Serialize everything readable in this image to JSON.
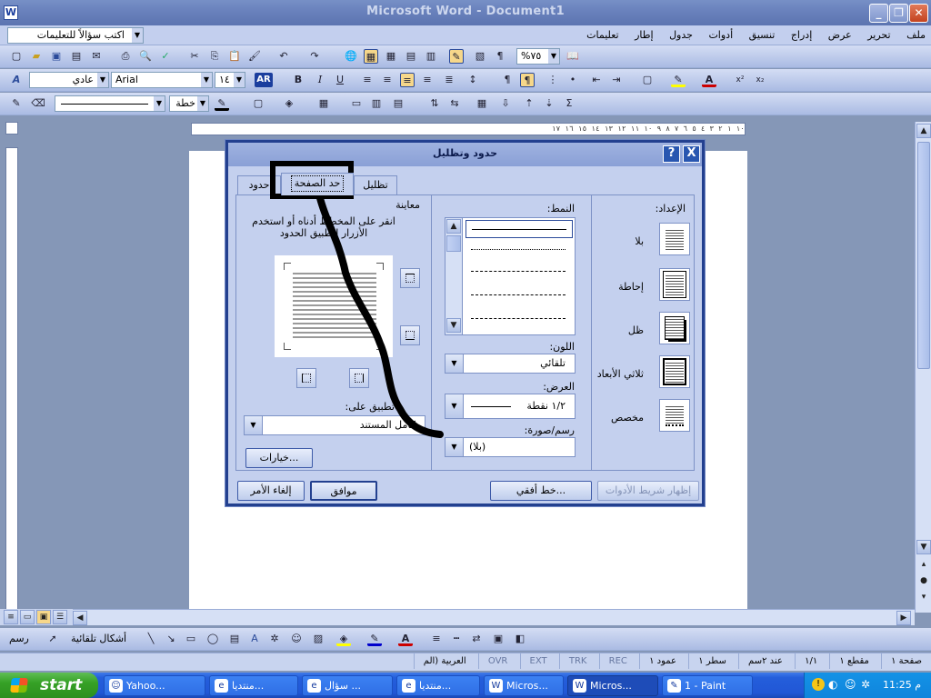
{
  "window": {
    "title": "Microsoft Word - Document1",
    "icon": "W"
  },
  "menubar": {
    "ask_placeholder": "اكتب سؤالاً للتعليمات",
    "menus": [
      "ملف",
      "تحرير",
      "عرض",
      "إدراج",
      "تنسيق",
      "أدوات",
      "جدول",
      "إطار",
      "تعليمات"
    ]
  },
  "toolbar_std": {
    "zoom": "%٧٥"
  },
  "toolbar_fmt": {
    "style": "عادي",
    "font": "Arial",
    "size": "١٤",
    "ar_label": "AR"
  },
  "toolbar_draw": {
    "line_style": "خطة"
  },
  "ruler_text": "١٠ ١ ٢ ٣ ٤ ٥ ٦ ٧ ٨ ٩ ١٠ ١١ ١٢ ١٣ ١٤ ١٥ ١٦ ١٧",
  "dialog": {
    "title": "حدود وتظليل",
    "help": "?",
    "close": "X",
    "tabs": [
      "حدود",
      "حد الصفحة",
      "تظليل"
    ],
    "active_tab": "حد الصفحة",
    "setting_label": "الإعداد:",
    "settings": [
      "بلا",
      "إحاطة",
      "ظل",
      "ثلاثي الأبعاد",
      "مخصص"
    ],
    "style_label": "النمط:",
    "color_label": "اللون:",
    "color_value": "تلقائي",
    "width_label": "العرض:",
    "width_value": "١/٢ نقطة",
    "art_label": "رسم/صورة:",
    "art_value": "(بلا)",
    "preview_label": "معاينة",
    "preview_hint": "انقر على المخطط أدناه أو استخدم الأزرار لتطبيق الحدود",
    "apply_label": "تطبيق على:",
    "apply_value": "كامل المستند",
    "options_button": "خيارات...",
    "show_toolbar_button": "إظهار شريط الأدوات",
    "horizontal_line_button": "خط أفقي...",
    "ok_button": "موافق",
    "cancel_button": "إلغاء الأمر"
  },
  "drawbar": {
    "draw_label": "رسم",
    "autoshapes_label": "أشكال تلقائية"
  },
  "statusbar": {
    "page": "صفحة ١",
    "section": "مقطع ١",
    "pages": "١/١",
    "at": "عند ٢سم",
    "line": "سطر ١",
    "column": "عمود ١",
    "rec": "REC",
    "trk": "TRK",
    "ext": "EXT",
    "ovr": "OVR",
    "language": "العربية (الم"
  },
  "taskbar": {
    "start": "start",
    "tasks": [
      "Yahoo...",
      "منتديا...",
      "سؤال ...",
      "منتديا...",
      "Micros...",
      "Micros...",
      "1 - Paint"
    ],
    "clock": "11:25 م"
  },
  "colors": {
    "accent": "#23408f",
    "annotation": "#000000"
  }
}
